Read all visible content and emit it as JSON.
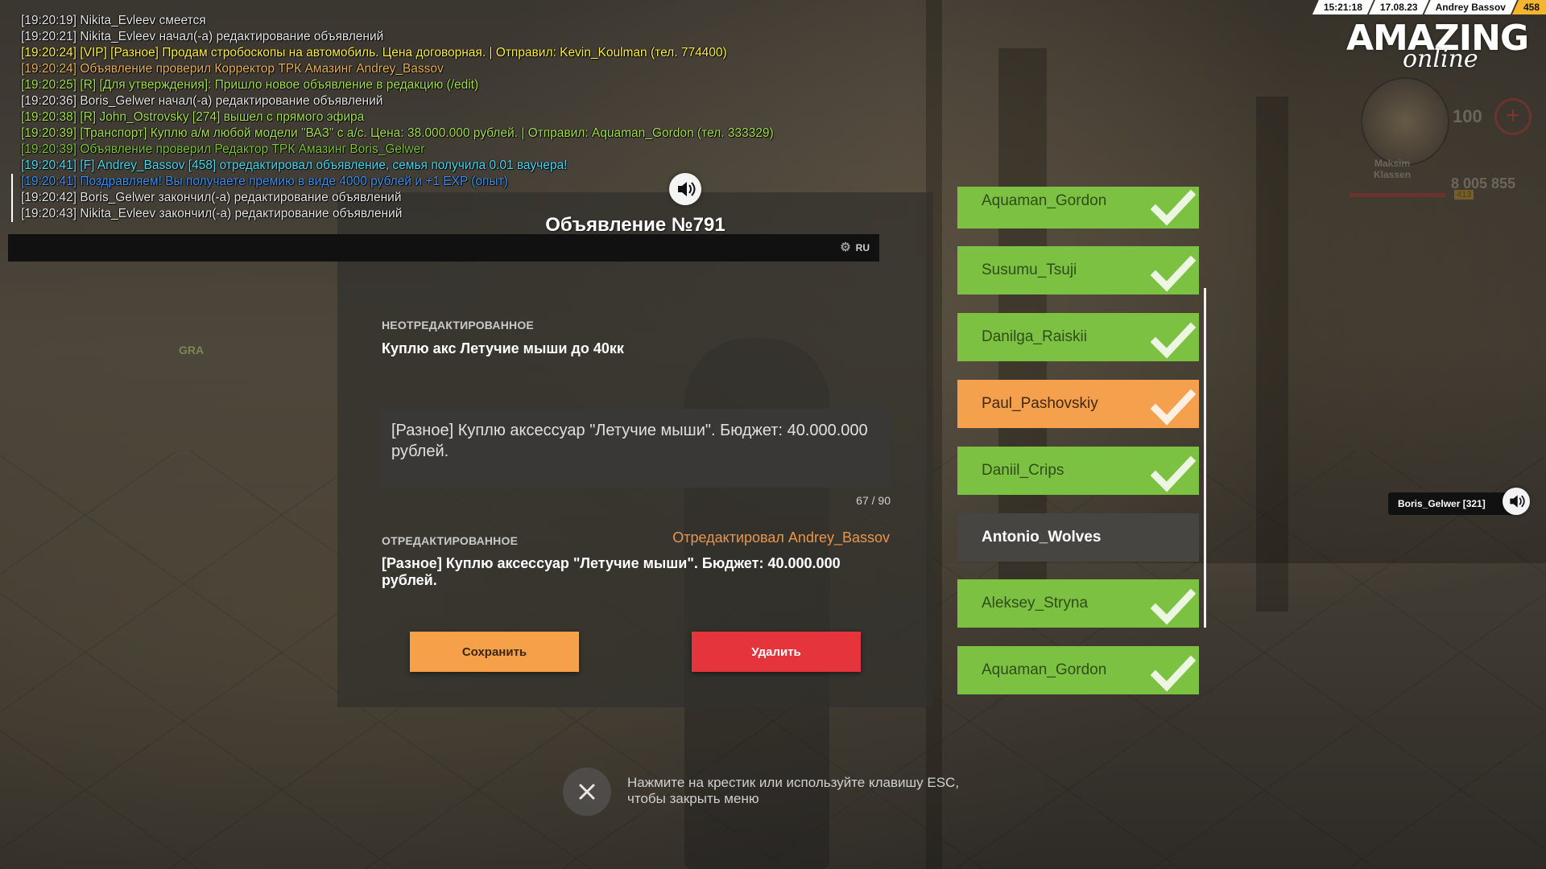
{
  "chat": [
    {
      "time": "[19:20:19]",
      "text": " Nikita_Evleev смеется",
      "color": "#e6e6e6",
      "marked": false
    },
    {
      "time": "[19:20:21]",
      "text": " Nikita_Evleev начал(-а) редактирование объявлений",
      "color": "#e6e6e6",
      "marked": false
    },
    {
      "time": "[19:20:24]",
      "text": " [VIP] [Разное] Продам стробоскопы на автомобиль. Цена договорная. | Отправил: Kevin_Koulman (тел. 774400)",
      "color": "#fdf040",
      "marked": false
    },
    {
      "time": "[19:20:24]",
      "text": " Объявление проверил Корректор ТРК Амазинг Andrey_Bassov",
      "color": "#e8b255",
      "marked": false
    },
    {
      "time": "[19:20:25]",
      "text": " [R] [Для утверждения]: Пришло новое объявление в редакцию (/edit)",
      "color": "#a5df4a",
      "marked": false
    },
    {
      "time": "[19:20:36]",
      "text": " Boris_Gelwer начал(-а) редактирование объявлений",
      "color": "#e6e6e6",
      "marked": false
    },
    {
      "time": "[19:20:38]",
      "text": " [R] John_Ostrovsky [274] вышел с прямого эфира",
      "color": "#a5df4a",
      "marked": false
    },
    {
      "time": "[19:20:39]",
      "text": " [Транспорт] Куплю а/м любой модели \"ВАЗ\" с а/с. Цена: 38.000.000 рублей. | Отправил: Aquaman_Gordon (тел. 333329)",
      "color": "#a5df4a",
      "marked": false
    },
    {
      "time": "[19:20:39]",
      "text": " Объявление проверил Редактор ТРК Амазинг Boris_Gelwer",
      "color": "#7fc436",
      "marked": false
    },
    {
      "time": "[19:20:41]",
      "text": " [F] Andrey_Bassov [458] отредактировал объявление, семья получила 0.01 ваучера!",
      "color": "#47d9f2",
      "marked": false
    },
    {
      "time": "[19:20:41]",
      "text": " Поздравляем! Вы получаете премию в виде 4000 рублей и +1 EXP (опыт)",
      "color": "#3c8ff0",
      "marked": true
    },
    {
      "time": "[19:20:42]",
      "text": " Boris_Gelwer закончил(-а) редактирование объявлений",
      "color": "#e6e6e6",
      "marked": true
    },
    {
      "time": "[19:20:43]",
      "text": " Nikita_Evleev закончил(-а) редактирование объявлений",
      "color": "#e6e6e6",
      "marked": true
    }
  ],
  "chat_input": {
    "lang": "RU",
    "icon": "gear-icon"
  },
  "hud": {
    "time": "15:21:18",
    "date": "17.08.23",
    "player": "Andrey Bassov",
    "player_id": "458",
    "logo_main": "AMAZING",
    "logo_sub": "online",
    "health": "100",
    "money": "8 005 855",
    "minimap_name": "Maksim\nKlassen",
    "level_chip": "413",
    "voice_tag": "Boris_Gelwer [321]",
    "npc_tag": "GRA"
  },
  "dialog": {
    "title": "Объявление №791",
    "original_label": "НЕОТРЕДАКТИРОВАННОЕ",
    "original_text": "Куплю акс Летучие мыши до 40кк",
    "edit_value": "[Разное] Куплю аксессуар \"Летучие мыши\". Бюджет: 40.000.000 рублей.",
    "char_count": "67 / 90",
    "edited_label": "ОТРЕДАКТИРОВАННОЕ",
    "edited_by": "Отредактировал Andrey_Bassov",
    "edited_text": "[Разное] Куплю аксессуар \"Летучие мыши\". Бюджет: 40.000.000 рублей.",
    "save_label": "Сохранить",
    "delete_label": "Удалить"
  },
  "editors": [
    {
      "name": "Aquaman_Gordon",
      "state": "green",
      "checked": true
    },
    {
      "name": "Susumu_Tsuji",
      "state": "green",
      "checked": true
    },
    {
      "name": "Danilga_Raiskii",
      "state": "green",
      "checked": true
    },
    {
      "name": "Paul_Pashovskiy",
      "state": "orange",
      "checked": true
    },
    {
      "name": "Daniil_Crips",
      "state": "green",
      "checked": true
    },
    {
      "name": "Antonio_Wolves",
      "state": "dark",
      "checked": false
    },
    {
      "name": "Aleksey_Stryna",
      "state": "green",
      "checked": true
    },
    {
      "name": "Aquaman_Gordon",
      "state": "green",
      "checked": true
    }
  ],
  "close_hint": "Нажмите на крестик или используйте клавишу ESC,\nчтобы закрыть меню",
  "colors": {
    "green": "#7dc142",
    "orange": "#f5a04c",
    "red": "#e5343c",
    "save": "#f6a04a",
    "accent_id": "#f5b52e"
  }
}
